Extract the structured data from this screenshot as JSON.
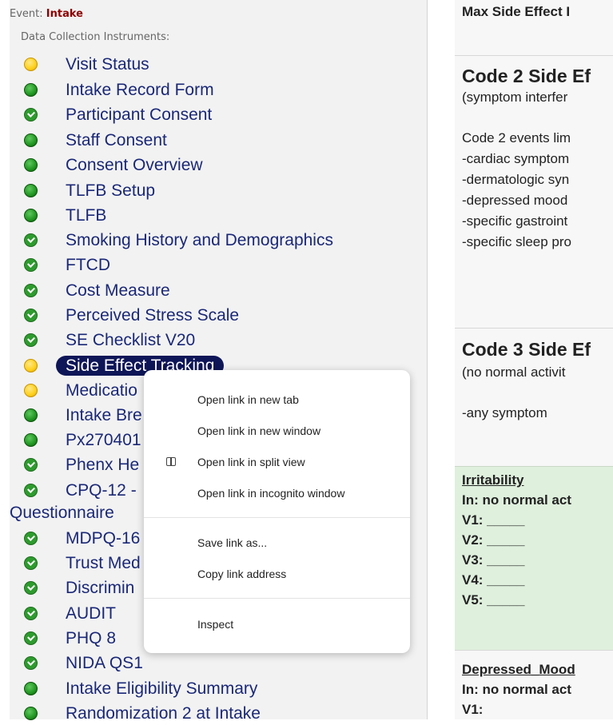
{
  "sidebar": {
    "event_label": "Event:",
    "event_name": "Intake",
    "instruments_heading": "Data Collection Instruments:",
    "items": [
      {
        "label": "Visit Status",
        "status": "yellow"
      },
      {
        "label": "Intake Record Form",
        "status": "green"
      },
      {
        "label": "Participant Consent",
        "status": "check"
      },
      {
        "label": "Staff Consent",
        "status": "green"
      },
      {
        "label": "Consent Overview",
        "status": "green"
      },
      {
        "label": "TLFB Setup",
        "status": "green"
      },
      {
        "label": "TLFB",
        "status": "green"
      },
      {
        "label": "Smoking History and Demographics",
        "status": "check"
      },
      {
        "label": "FTCD",
        "status": "check"
      },
      {
        "label": "Cost Measure",
        "status": "check"
      },
      {
        "label": "Perceived Stress Scale",
        "status": "check"
      },
      {
        "label": "SE Checklist V20",
        "status": "check"
      },
      {
        "label": "Side Effect Tracking",
        "status": "yellow"
      },
      {
        "label": "Medicatio",
        "status": "yellow"
      },
      {
        "label": "Intake Bre",
        "status": "green"
      },
      {
        "label": "Px270401",
        "status": "green"
      },
      {
        "label": "Phenx He",
        "status": "check"
      },
      {
        "label": "CPQ-12 -",
        "label2": "Questionnaire",
        "status": "check"
      },
      {
        "label": "MDPQ-16",
        "status": "check"
      },
      {
        "label": "Trust Med",
        "status": "check"
      },
      {
        "label": "Discrimin",
        "status": "check"
      },
      {
        "label": "AUDIT",
        "status": "check"
      },
      {
        "label": "PHQ 8",
        "status": "check"
      },
      {
        "label": "NIDA QS1",
        "status": "check"
      },
      {
        "label": "Intake Eligibility Summary",
        "status": "green"
      },
      {
        "label": "Randomization 2 at Intake",
        "status": "green"
      }
    ]
  },
  "content": {
    "max_header": "Max Side Effect I",
    "code2_title": "Code 2 Side Ef",
    "code2_sub": "(symptom interfer",
    "code2_lines": [
      "Code 2 events lim",
      "-cardiac symptom",
      "-dermatologic syn",
      "-depressed mood",
      "-specific gastroint",
      "-specific sleep pro"
    ],
    "code3_title": "Code 3 Side Ef",
    "code3_sub": "(no normal activit",
    "code3_line": "-any symptom",
    "irritability": {
      "title": "Irritability",
      "in": "In: no normal act",
      "visits": [
        "V1: _____",
        "V2: _____",
        "V3: _____",
        "V4: _____",
        "V5: _____"
      ]
    },
    "depressed": {
      "title": "Depressed_Mood",
      "in": "In: no normal act",
      "v1": "V1:"
    }
  },
  "context_menu": {
    "items": [
      "Open link in new tab",
      "Open link in new window",
      "Open link in split view",
      "Open link in incognito window",
      "Save link as...",
      "Copy link address",
      "Inspect"
    ]
  }
}
